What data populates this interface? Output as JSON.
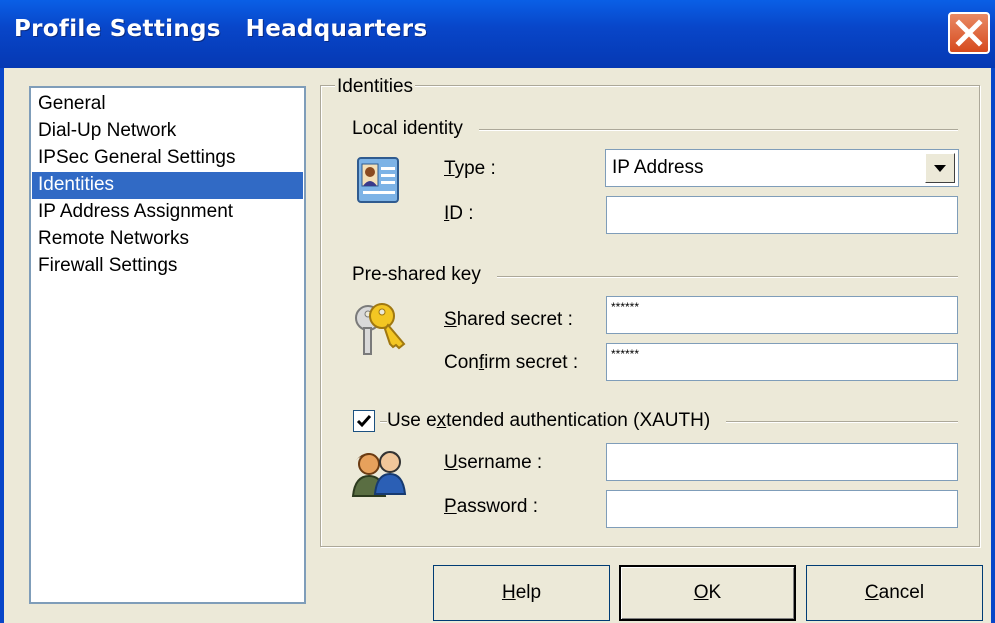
{
  "window": {
    "title": "Profile Settings   Headquarters",
    "close_glyph": "×"
  },
  "nav": {
    "items": [
      {
        "label": "General",
        "selected": false
      },
      {
        "label": "Dial-Up Network",
        "selected": false
      },
      {
        "label": "IPSec General Settings",
        "selected": false
      },
      {
        "label": "Identities",
        "selected": true
      },
      {
        "label": "IP Address Assignment",
        "selected": false
      },
      {
        "label": "Remote Networks",
        "selected": false
      },
      {
        "label": "Firewall Settings",
        "selected": false
      }
    ]
  },
  "panel": {
    "title": "Identities",
    "local_identity": {
      "title": "Local identity",
      "icon": "id-card-icon",
      "type_label": {
        "mnemonic": "T",
        "rest": "ype :"
      },
      "type_value": "IP Address",
      "id_label": {
        "mnemonic": "I",
        "rest": "D :"
      },
      "id_value": ""
    },
    "preshared_key": {
      "title": "Pre-shared key",
      "icon": "keys-icon",
      "shared_label": {
        "mnemonic": "S",
        "rest": "hared secret :"
      },
      "shared_value": "******",
      "confirm_label": {
        "pre": "Con",
        "mnemonic": "f",
        "rest": "irm secret :"
      },
      "confirm_value": "******"
    },
    "xauth": {
      "checked": true,
      "label": {
        "pre": "Use e",
        "mnemonic": "x",
        "rest": "tended authentication (XAUTH)"
      },
      "icon": "users-icon",
      "username_label": {
        "mnemonic": "U",
        "rest": "sername :"
      },
      "username_value": "",
      "password_label": {
        "mnemonic": "P",
        "rest": "assword :"
      },
      "password_value": ""
    }
  },
  "buttons": {
    "help": {
      "mnemonic": "H",
      "rest": "elp"
    },
    "ok": {
      "mnemonic": "O",
      "rest": "K"
    },
    "cancel": {
      "mnemonic": "C",
      "rest": "ancel"
    }
  },
  "colors": {
    "titlebar": "#0846c9",
    "selection": "#316ac5",
    "dialog_bg": "#ece9d8",
    "close_button": "#d64a1e"
  }
}
